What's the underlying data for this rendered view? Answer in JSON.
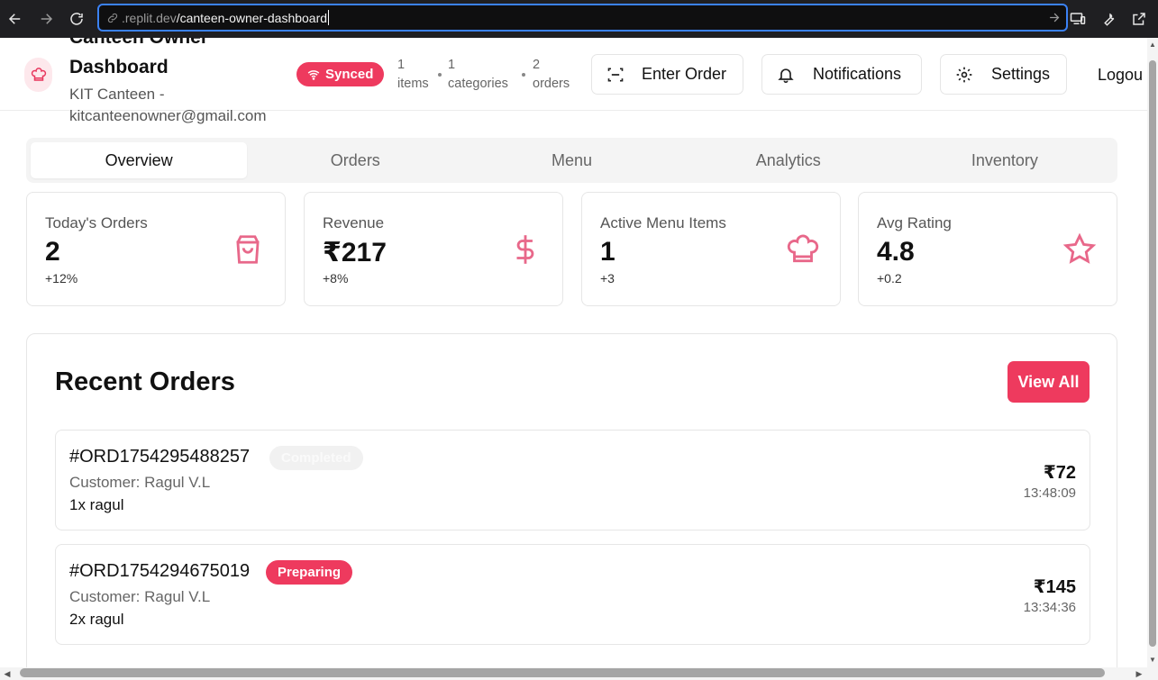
{
  "browser": {
    "url_dim": ".replit.dev",
    "url_path": "/canteen-owner-dashboard"
  },
  "header": {
    "title_line1": "Canteen Owner",
    "title_line2": "Dashboard",
    "subtitle_line1": "KIT Canteen -",
    "subtitle_line2": "kitcanteenowner@gmail.com",
    "sync_status": "Synced",
    "stats": [
      {
        "num": "1",
        "label": "items"
      },
      {
        "num": "1",
        "label": "categories"
      },
      {
        "num": "2",
        "label": "orders"
      }
    ],
    "enter_order_label": "Enter Order",
    "notifications_label": "Notifications",
    "settings_label": "Settings",
    "logout_label": "Logou"
  },
  "tabs": [
    {
      "label": "Overview",
      "active": true
    },
    {
      "label": "Orders",
      "active": false
    },
    {
      "label": "Menu",
      "active": false
    },
    {
      "label": "Analytics",
      "active": false
    },
    {
      "label": "Inventory",
      "active": false
    }
  ],
  "cards": [
    {
      "label": "Today's Orders",
      "value": "2",
      "delta": "+12%",
      "icon": "shopping-bag-icon"
    },
    {
      "label": "Revenue",
      "value": "₹217",
      "delta": "+8%",
      "icon": "dollar-icon"
    },
    {
      "label": "Active Menu Items",
      "value": "1",
      "delta": "+3",
      "icon": "chef-hat-icon"
    },
    {
      "label": "Avg Rating",
      "value": "4.8",
      "delta": "+0.2",
      "icon": "star-icon"
    }
  ],
  "recent": {
    "title": "Recent Orders",
    "view_all_label": "View All",
    "orders": [
      {
        "id": "#ORD1754295488257",
        "status": "Completed",
        "customer": "Customer: Ragul V.L",
        "items": "1x ragul",
        "amount": "₹72",
        "time": "13:48:09"
      },
      {
        "id": "#ORD1754294675019",
        "status": "Preparing",
        "customer": "Customer: Ragul V.L",
        "items": "2x ragul",
        "amount": "₹145",
        "time": "13:34:36"
      }
    ]
  },
  "colors": {
    "accent": "#ee3a5e",
    "icon_pink": "#e8688a"
  }
}
